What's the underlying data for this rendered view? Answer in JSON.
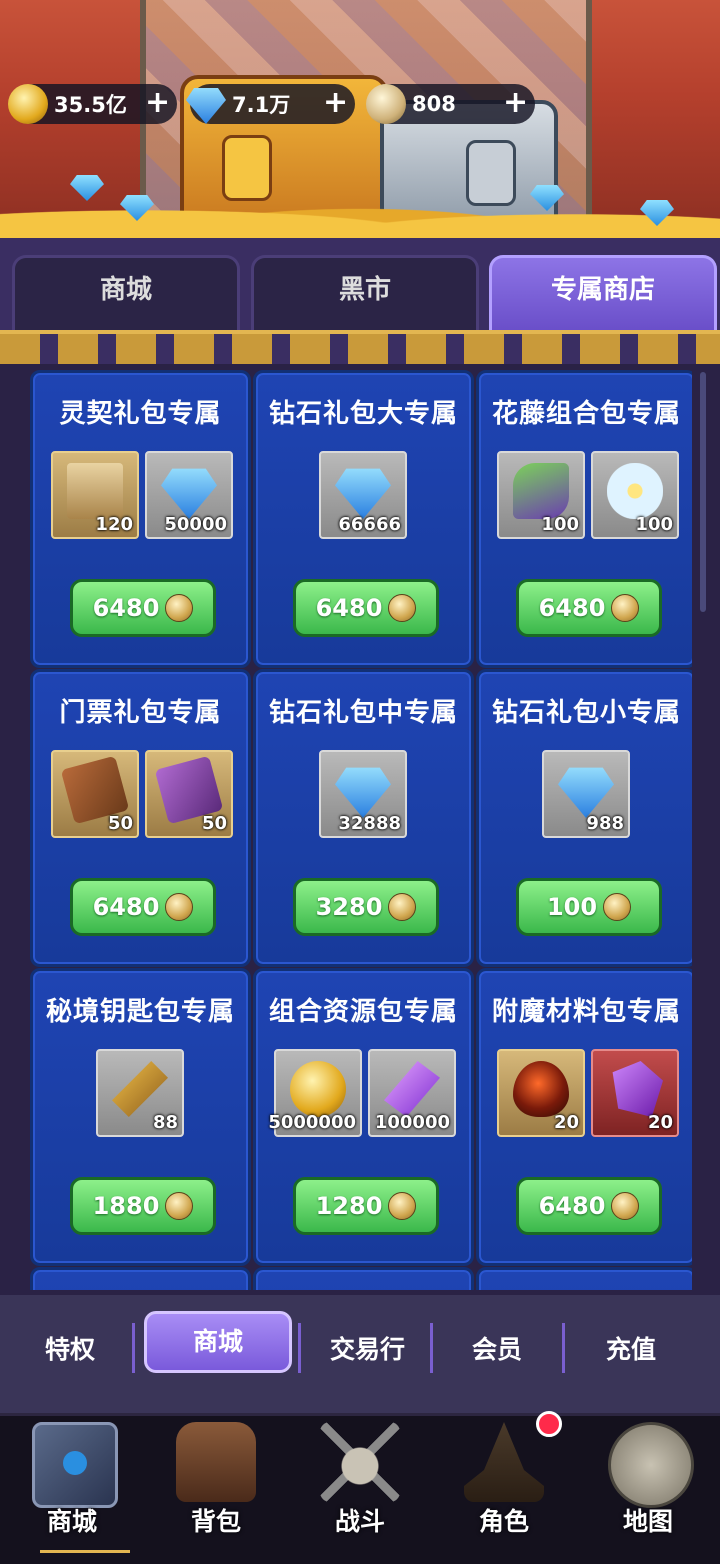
{
  "currencies": [
    {
      "value": "35.5亿",
      "icon": "gold-coin-icon"
    },
    {
      "value": "7.1万",
      "icon": "diamond-icon"
    },
    {
      "value": "808",
      "icon": "silver-coin-icon"
    }
  ],
  "tabs": [
    {
      "label": "商城"
    },
    {
      "label": "黑市"
    },
    {
      "label": "专属商店",
      "active": true
    }
  ],
  "cards": [
    {
      "title": "灵契礼包专属",
      "items": [
        {
          "icon": "contract-scroll-icon",
          "qty": "120"
        },
        {
          "icon": "diamond-icon",
          "qty": "50000"
        }
      ],
      "price": "6480"
    },
    {
      "title": "钻石礼包大专属",
      "items": [
        {
          "icon": "diamond-icon",
          "qty": "66666"
        }
      ],
      "price": "6480"
    },
    {
      "title": "花藤组合包专属",
      "items": [
        {
          "icon": "vine-icon",
          "qty": "100"
        },
        {
          "icon": "flower-icon",
          "qty": "100"
        }
      ],
      "price": "6480"
    },
    {
      "title": "门票礼包专属",
      "items": [
        {
          "icon": "ticket-icon",
          "qty": "50"
        },
        {
          "icon": "purple-ticket-icon",
          "qty": "50"
        }
      ],
      "price": "6480"
    },
    {
      "title": "钻石礼包中专属",
      "items": [
        {
          "icon": "diamond-icon",
          "qty": "32888"
        }
      ],
      "price": "3280"
    },
    {
      "title": "钻石礼包小专属",
      "items": [
        {
          "icon": "diamond-icon",
          "qty": "988"
        }
      ],
      "price": "100"
    },
    {
      "title": "秘境钥匙包专属",
      "items": [
        {
          "icon": "key-icon",
          "qty": "88"
        }
      ],
      "price": "1880"
    },
    {
      "title": "组合资源包专属",
      "items": [
        {
          "icon": "gold-coin-icon",
          "qty": "5000000"
        },
        {
          "icon": "crystal-icon",
          "qty": "100000"
        }
      ],
      "price": "1280"
    },
    {
      "title": "附魔材料包专属",
      "items": [
        {
          "icon": "egg-icon",
          "qty": "20"
        },
        {
          "icon": "purple-ore-icon",
          "qty": "20"
        }
      ],
      "price": "6480"
    }
  ],
  "subnav": [
    {
      "label": "特权"
    },
    {
      "label": "商城",
      "active": true
    },
    {
      "label": "交易行"
    },
    {
      "label": "会员"
    },
    {
      "label": "充值"
    }
  ],
  "bottom_nav": [
    {
      "label": "商城",
      "icon": "book-icon",
      "active": true
    },
    {
      "label": "背包",
      "icon": "backpack-icon"
    },
    {
      "label": "战斗",
      "icon": "skull-swords-icon"
    },
    {
      "label": "角色",
      "icon": "wizard-hat-icon"
    },
    {
      "label": "地图",
      "icon": "map-icon"
    }
  ],
  "colors": {
    "price_button": "#3bb84b",
    "card_bg": "#1f44b3",
    "active_tab": "#7a5adb",
    "notification_dot": "#ff2a4a"
  }
}
